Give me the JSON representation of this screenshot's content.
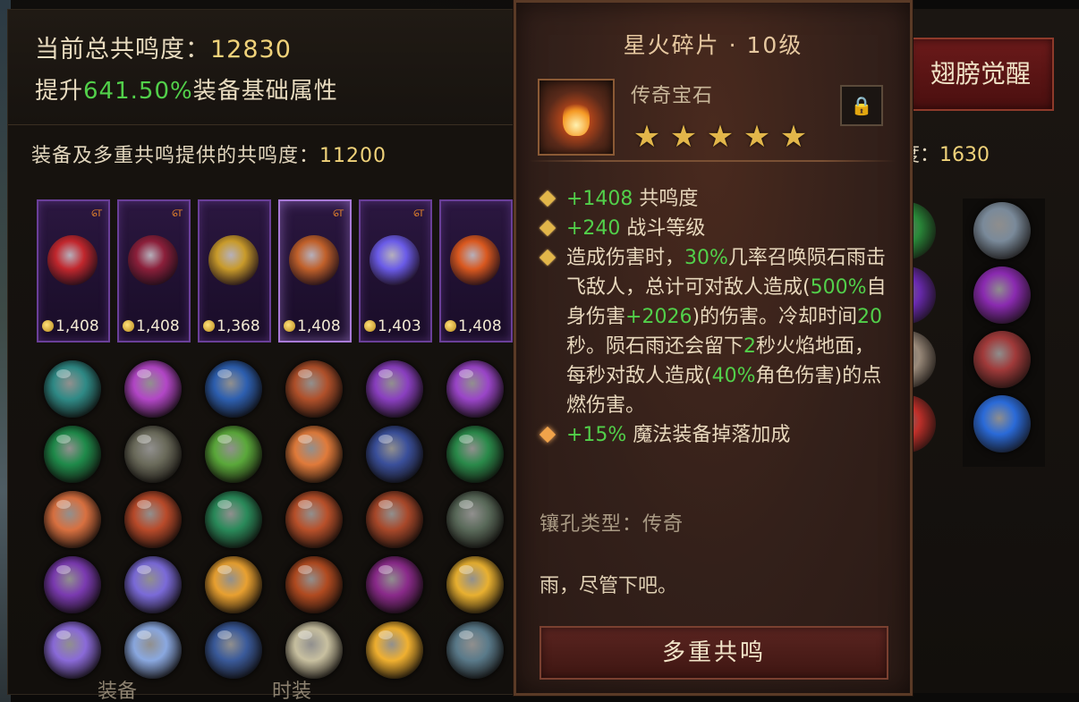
{
  "summary": {
    "total_label": "当前总共鸣度：",
    "total_value": "12830",
    "boost_prefix": "提升",
    "boost_pct": "641.50%",
    "boost_suffix": "装备基础属性"
  },
  "equipment": {
    "title_label": "装备及多重共鸣提供的共鸣度：",
    "title_value": "11200",
    "cards": [
      {
        "value": "1,408",
        "has_mark": true,
        "color": "#c1272d"
      },
      {
        "value": "1,408",
        "has_mark": true,
        "color": "#8b1f3a"
      },
      {
        "value": "1,368",
        "has_mark": false,
        "color": "#c89a2a"
      },
      {
        "value": "1,408",
        "has_mark": true,
        "color": "#c0602a"
      },
      {
        "value": "1,403",
        "has_mark": true,
        "color": "#6a5be8"
      },
      {
        "value": "1,408",
        "has_mark": false,
        "color": "#d9581f"
      }
    ]
  },
  "gem_grid": {
    "rows": [
      [
        "#2f8a86",
        "#b246c6",
        "#2d5fb0",
        "#b0502a",
        "#8a3fc0",
        "#9a45c8"
      ],
      [
        "#1f8a4a",
        "#6a6a5a",
        "#5aa83a",
        "#e07a3a",
        "#3a4f9a",
        "#2a8a4a"
      ],
      [
        "#d87040",
        "#b84a2a",
        "#2a8a5a",
        "#b8502a",
        "#a8482a",
        "#5a6a5a"
      ],
      [
        "#7a3ab0",
        "#7a6ad8",
        "#e8a030",
        "#b04a20",
        "#8a2a8a",
        "#e8b030"
      ],
      [
        "#8a6ad8",
        "#8aa8e0",
        "#3a5a9a",
        "#c8c0a0",
        "#f0b030",
        "#5a7a8a"
      ]
    ]
  },
  "bottom_tabs": [
    "装备",
    "时装"
  ],
  "right_panel": {
    "wing_label": "翅膀觉醒",
    "sub_label": "度：",
    "sub_value": "1630",
    "gems": [
      "#7a8a9a",
      "#8a2ab0",
      "#a03a3a",
      "#2a6ad8"
    ],
    "partials": [
      "#2a8a3a",
      "#6a2ab0",
      "#9a8a7a",
      "#c0302a"
    ]
  },
  "tooltip": {
    "title": "星火碎片 · 10级",
    "type": "传奇宝石",
    "lock_icon": "lock-icon",
    "stars": 5,
    "lines": [
      {
        "kind": "stat",
        "value": "+1408",
        "label": " 共鸣度"
      },
      {
        "kind": "stat",
        "value": "+240",
        "label": " 战斗等级"
      }
    ],
    "effect": {
      "p1": "造成伤害时，",
      "v1": "30%",
      "p2": "几率召唤陨石雨击飞敌人，总计可对敌人造成(",
      "v2": "500%",
      "p3": "自身伤害",
      "v3": "+2026",
      "p4": ")的伤害。冷却时间",
      "v4": "20",
      "p5": "秒。陨石雨还会留下",
      "v5": "2",
      "p6": "秒火焰地面，每秒对敌人造成(",
      "v6": "40%",
      "p7": "角色伤害)的点燃伤害。"
    },
    "bonus": {
      "value": "+15%",
      "label": " 魔法装备掉落加成"
    },
    "socket": "镶孔类型：传奇",
    "flavor": "雨，尽管下吧。",
    "button_label": "多重共鸣"
  }
}
